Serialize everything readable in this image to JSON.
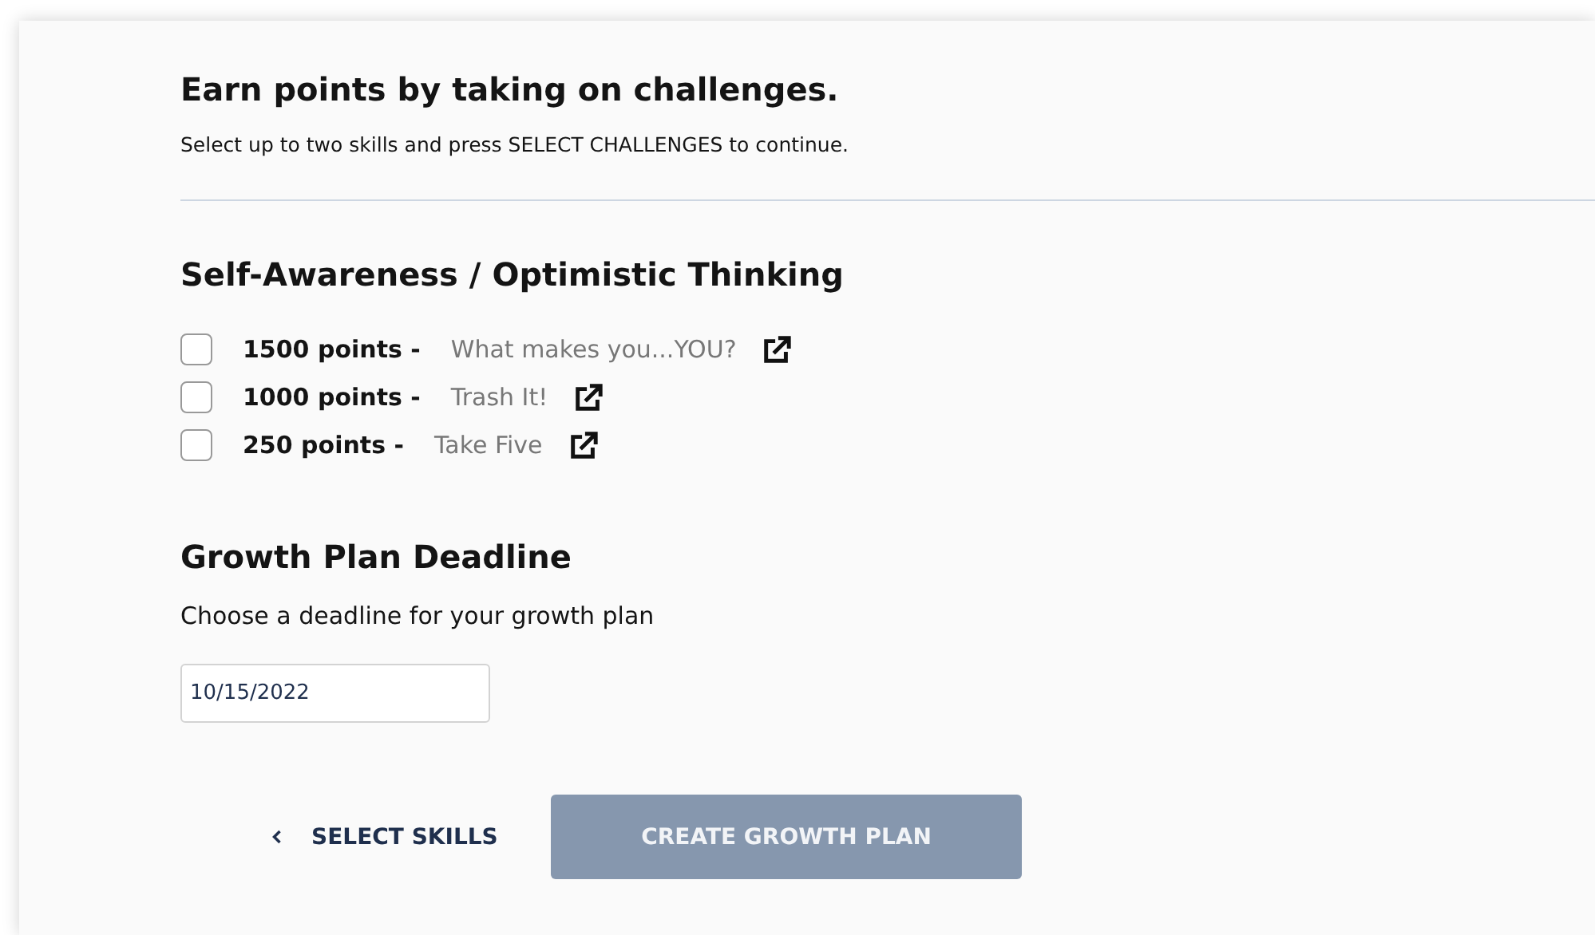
{
  "header": {
    "title": "Earn points by taking on challenges.",
    "instructions": "Select up to two skills and press SELECT CHALLENGES to continue."
  },
  "skill_group": {
    "title": "Self-Awareness / Optimistic Thinking",
    "challenges": [
      {
        "points": "1500 points -",
        "name": "What makes you...YOU?",
        "checked": false
      },
      {
        "points": "1000 points -",
        "name": "Trash It!",
        "checked": false
      },
      {
        "points": "250 points -",
        "name": "Take Five",
        "checked": false
      }
    ]
  },
  "deadline": {
    "title": "Growth Plan Deadline",
    "label": "Choose a deadline for your growth plan",
    "value": "10/15/2022"
  },
  "buttons": {
    "back": "SELECT SKILLS",
    "create": {
      "label": "CREATE GROWTH PLAN",
      "disabled": true
    }
  }
}
